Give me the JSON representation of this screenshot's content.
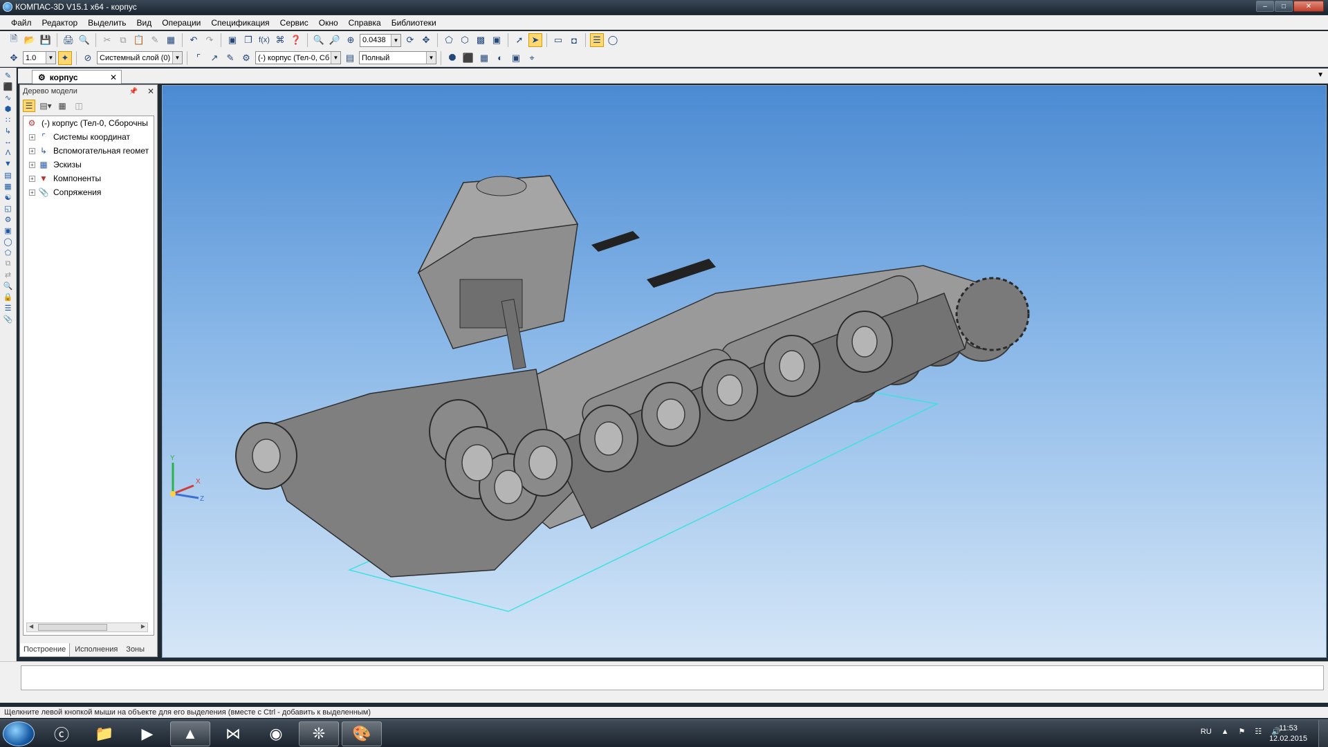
{
  "window": {
    "title": "КОМПАС-3D V15.1 x64 - корпус"
  },
  "menu": [
    "Файл",
    "Редактор",
    "Выделить",
    "Вид",
    "Операции",
    "Спецификация",
    "Сервис",
    "Окно",
    "Справка",
    "Библиотеки"
  ],
  "toolbar": {
    "zoom_value": "0.0438",
    "step_value": "1.0",
    "layer": "Системный слой (0)",
    "object": "(-) корпус (Тел-0, Сб",
    "display_mode": "Полный"
  },
  "document_tab": {
    "label": "корпус"
  },
  "tree_panel": {
    "title": "Дерево модели",
    "root": "(-) корпус (Тел-0, Сборочны",
    "items": [
      {
        "label": "Системы координат",
        "icon": "coordinate-systems-icon"
      },
      {
        "label": "Вспомогательная геомет",
        "icon": "auxiliary-geometry-icon"
      },
      {
        "label": "Эскизы",
        "icon": "sketches-icon"
      },
      {
        "label": "Компоненты",
        "icon": "components-icon"
      },
      {
        "label": "Сопряжения",
        "icon": "mates-icon"
      }
    ],
    "bottom_tabs": [
      "Построение",
      "Исполнения",
      "Зоны"
    ]
  },
  "viewport": {
    "background_top": "#4b8ad2",
    "background_bottom": "#d5e6f7",
    "model_color": "#8a8a8a",
    "axes": {
      "x": "X",
      "y": "Y",
      "z": "Z"
    }
  },
  "status": {
    "hint": "Щелкните левой кнопкой мыши на объекте для его выделения (вместе с Ctrl - добавить к выделенным)"
  },
  "taskbar": {
    "apps": [
      "internet-explorer",
      "explorer",
      "media-player",
      "aimp",
      "visual-studio",
      "chrome",
      "kompas",
      "paint"
    ],
    "language": "RU",
    "time": "11:53",
    "date": "12.02.2015"
  }
}
